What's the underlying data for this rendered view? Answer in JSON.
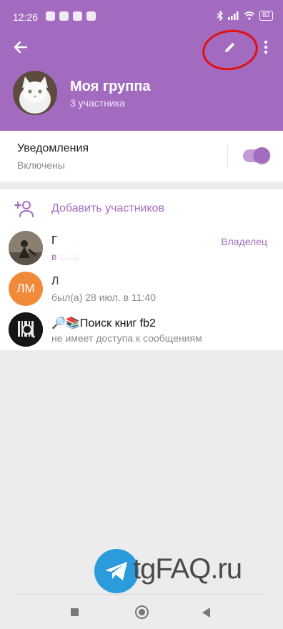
{
  "status_bar": {
    "time": "12:26",
    "battery": "82"
  },
  "group": {
    "name": "Моя группа",
    "subtitle": "3 участника"
  },
  "notifications": {
    "title": "Уведомления",
    "state": "Включены",
    "enabled": true
  },
  "add_members": {
    "label": "Добавить участников"
  },
  "members": [
    {
      "name": "Г",
      "status": "в сети",
      "role": "Владелец",
      "avatar_initials": ""
    },
    {
      "name": "Л",
      "status": "был(а) 28 июл. в 11:40",
      "role": "",
      "avatar_initials": "ЛМ"
    },
    {
      "name": "🔎📚Поиск книг fb2",
      "status": "не имеет доступа к сообщениям",
      "role": "",
      "avatar_initials": ""
    }
  ],
  "watermark": {
    "text": "tgFAQ.ru"
  },
  "colors": {
    "accent": "#a36bbf",
    "annotation": "#e01010",
    "avatar_lm": "#f08a3a"
  },
  "icons": [
    "back-arrow-icon",
    "pencil-icon",
    "more-vert-icon",
    "add-user-icon",
    "telegram-icon"
  ]
}
